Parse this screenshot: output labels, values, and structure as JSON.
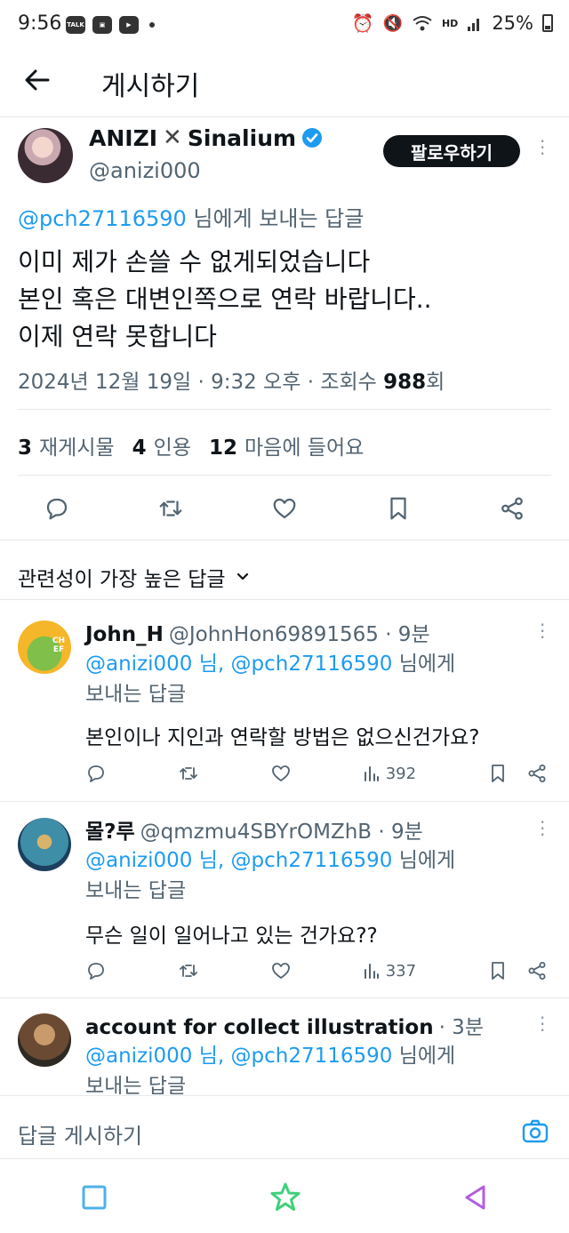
{
  "status_bar": {
    "time": "9:56",
    "battery": "25%",
    "icons": [
      "talk-icon",
      "gallery-icon",
      "youtube-icon",
      "alarm-icon",
      "mute-icon",
      "wifi-icon",
      "hd-voice-icon",
      "signal-icon",
      "battery-icon"
    ],
    "talk_badge": "TALK",
    "hd_badge": "HD"
  },
  "header": {
    "title": "게시하기"
  },
  "tweet": {
    "display_name_part1": "ANIZI",
    "display_name_part2": "Sinalium",
    "handle": "@anizi000",
    "follow_label": "팔로우하기",
    "reply_to_mention": "@pch27116590",
    "reply_to_suffix": " 님에게 보내는 답글",
    "body_lines": [
      "이미 제가 손쓸 수 없게되었습니다",
      "본인 혹은 대변인쪽으로 연락 바랍니다..",
      "이제 연락 못합니다"
    ],
    "meta_prefix": "2024년 12월 19일 · 9:32 오후 · 조회수 ",
    "views": "988",
    "meta_suffix": "회",
    "retweets_count": "3",
    "retweets_label": "재게시물",
    "quotes_count": "4",
    "quotes_label": "인용",
    "likes_count": "12",
    "likes_label": "마음에 들어요"
  },
  "sort": {
    "label": "관련성이 가장 높은 답글"
  },
  "replies": [
    {
      "name": "John_H",
      "handle_time": "@JohnHon69891565 · 9분",
      "mentions": "@anizi000 님, @pch27116590",
      "reply_suffix_1": " 님에게",
      "reply_suffix_2": "보내는 답글",
      "text": "본인이나 지인과 연락할 방법은 없으신건가요?",
      "views": "392",
      "avatar_text": "CH EF"
    },
    {
      "name": "몰?루",
      "handle_time": "@qmzmu4SBYrOMZhB · 9분",
      "mentions": "@anizi000 님, @pch27116590",
      "reply_suffix_1": " 님에게",
      "reply_suffix_2": "보내는 답글",
      "text": "무슨 일이 일어나고 있는 건가요??",
      "views": "337"
    },
    {
      "name": "account for collect illustration",
      "handle_time": "· 3분",
      "mentions": "@anizi000 님, @pch27116590",
      "reply_suffix_1": " 님에게",
      "reply_suffix_2": "보내는 답글"
    }
  ],
  "compose": {
    "placeholder": "답글 게시하기"
  },
  "colors": {
    "accent": "#1d9bf0",
    "text": "#0f1419",
    "muted": "#536471",
    "nav_recents": "#4fb0ea",
    "nav_home": "#3fd07a",
    "nav_back": "#b05ee0"
  }
}
